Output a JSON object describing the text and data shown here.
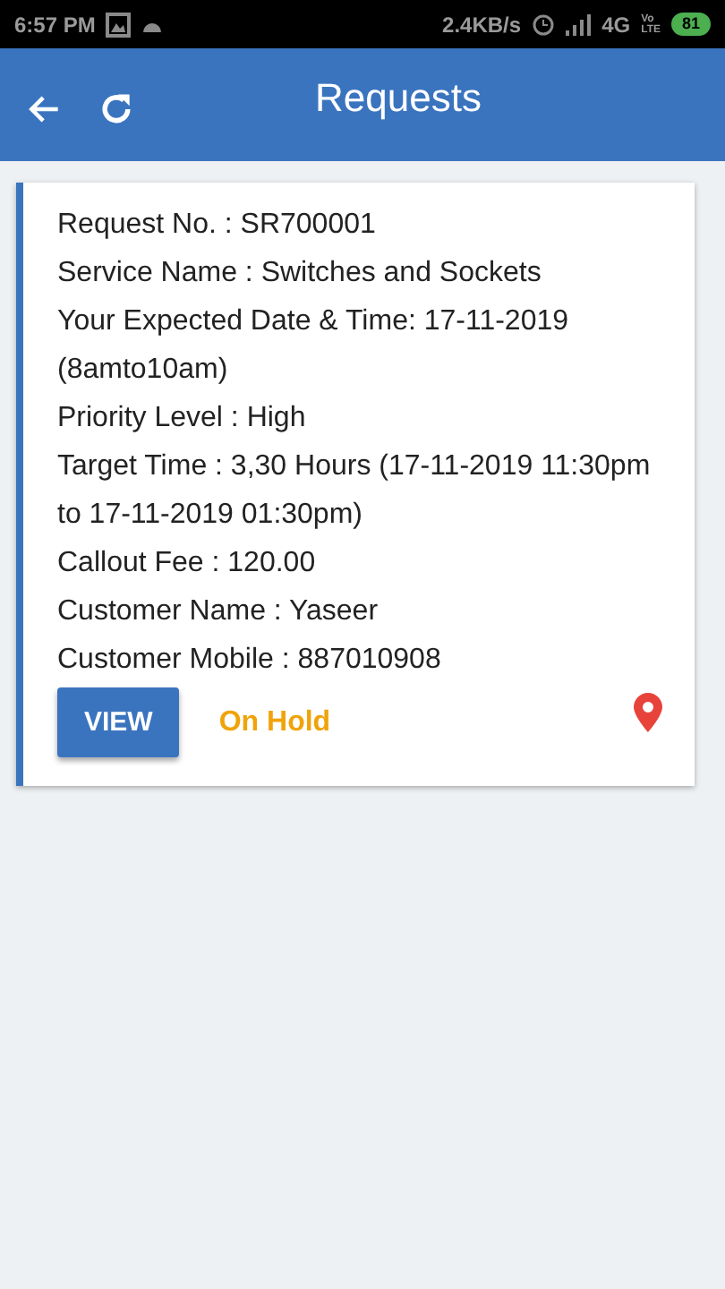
{
  "status_bar": {
    "time": "6:57 PM",
    "speed": "2.4KB/s",
    "network": "4G",
    "volte_top": "Vo",
    "volte_bottom": "LTE",
    "battery": "81"
  },
  "app_bar": {
    "title": "Requests"
  },
  "requests": [
    {
      "lines": [
        "Request No. : SR700001",
        "Service Name : Switches and Sockets",
        "Your Expected Date & Time: 17-11-2019 (8amto10am)",
        "Priority Level : High",
        "Target Time : 3,30 Hours (17-11-2019 11:30pm to 17-11-2019 01:30pm)",
        "Callout Fee : 120.00",
        "Customer Name : Yaseer",
        "Customer Mobile : 887010908"
      ],
      "button": "VIEW",
      "status": "On Hold",
      "color": "#f0a30a"
    }
  ]
}
